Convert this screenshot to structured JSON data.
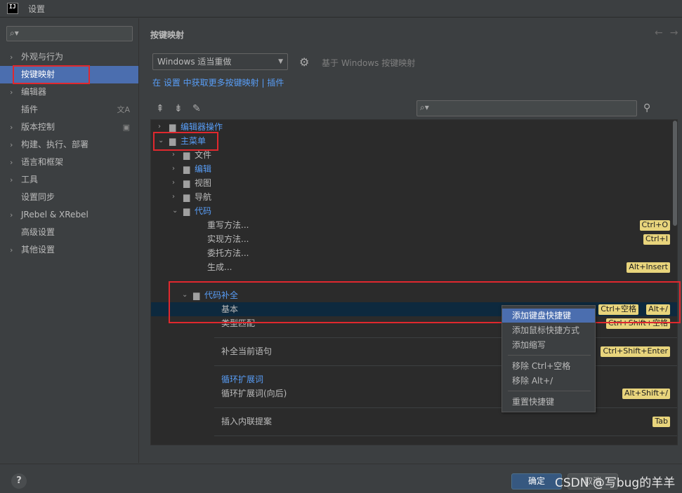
{
  "window": {
    "title": "设置",
    "logo_text": "IJ"
  },
  "sidebar": {
    "search_icon": "search-icon",
    "items": [
      {
        "label": "外观与行为",
        "expandable": true
      },
      {
        "label": "按键映射",
        "expandable": false,
        "selected": true
      },
      {
        "label": "编辑器",
        "expandable": true
      },
      {
        "label": "插件",
        "expandable": false,
        "side_icon": "文A"
      },
      {
        "label": "版本控制",
        "expandable": true,
        "side_icon": "▣"
      },
      {
        "label": "构建、执行、部署",
        "expandable": true
      },
      {
        "label": "语言和框架",
        "expandable": true
      },
      {
        "label": "工具",
        "expandable": true
      },
      {
        "label": "设置同步",
        "expandable": false
      },
      {
        "label": "JRebel & XRebel",
        "expandable": true
      },
      {
        "label": "高级设置",
        "expandable": false
      },
      {
        "label": "其他设置",
        "expandable": true
      }
    ]
  },
  "main": {
    "title": "按键映射",
    "keymap_value": "Windows 适当重做",
    "based_on": "基于 Windows 按键映射",
    "link_prefix": "在 设置 中",
    "link_more": "获取更多按键映射",
    "link_sep": "|",
    "link_plugins": "插件"
  },
  "tree": {
    "rows": [
      {
        "label": "编辑器操作",
        "level": 0,
        "chev": "›",
        "blue": true
      },
      {
        "label": "主菜单",
        "level": 0,
        "chev": "⌄",
        "blue": true
      },
      {
        "label": "文件",
        "level": 1,
        "chev": "›",
        "blue": false
      },
      {
        "label": "编辑",
        "level": 1,
        "chev": "›",
        "blue": true
      },
      {
        "label": "视图",
        "level": 1,
        "chev": "›",
        "blue": false
      },
      {
        "label": "导航",
        "level": 1,
        "chev": "›",
        "blue": false
      },
      {
        "label": "代码",
        "level": 1,
        "chev": "⌄",
        "blue": true
      },
      {
        "label": "重写方法...",
        "level": 2,
        "keys": [
          "Ctrl+O"
        ]
      },
      {
        "label": "实现方法...",
        "level": 2,
        "keys": [
          "Ctrl+I"
        ]
      },
      {
        "label": "委托方法...",
        "level": 2,
        "keys": []
      },
      {
        "label": "生成...",
        "level": 2,
        "keys": [
          "Alt+Insert"
        ]
      },
      {
        "label": "代码补全",
        "level": 2,
        "chev": "⌄",
        "blue": true,
        "folder": true
      },
      {
        "label": "基本",
        "level": 3,
        "keys": [
          "Ctrl+空格",
          "Alt+/"
        ],
        "selected": true
      },
      {
        "label": "类型匹配",
        "level": 3,
        "keys": [
          "Ctrl+Shift+空格"
        ]
      },
      {
        "label": "补全当前语句",
        "level": 3,
        "keys": [
          "Ctrl+Shift+Enter"
        ]
      },
      {
        "label": "循环扩展词",
        "level": 3,
        "keys": [],
        "blue": true
      },
      {
        "label": "循环扩展词(向后)",
        "level": 3,
        "keys": [
          "Alt+Shift+/"
        ]
      },
      {
        "label": "插入内联提案",
        "level": 3,
        "keys": [
          "Tab"
        ]
      }
    ]
  },
  "context_menu": {
    "items": [
      "添加键盘快捷键",
      "添加鼠标快捷方式",
      "添加缩写",
      "移除 Ctrl+空格",
      "移除 Alt+/",
      "重置快捷键"
    ]
  },
  "footer": {
    "help": "?",
    "ok": "确定",
    "cancel": "取消",
    "watermark": "CSDN @写bug的羊羊"
  },
  "colors": {
    "accent": "#4b6eaf",
    "link": "#589df6",
    "shortcut_bg": "#e8d47c",
    "highlight_border": "#e0282e"
  }
}
